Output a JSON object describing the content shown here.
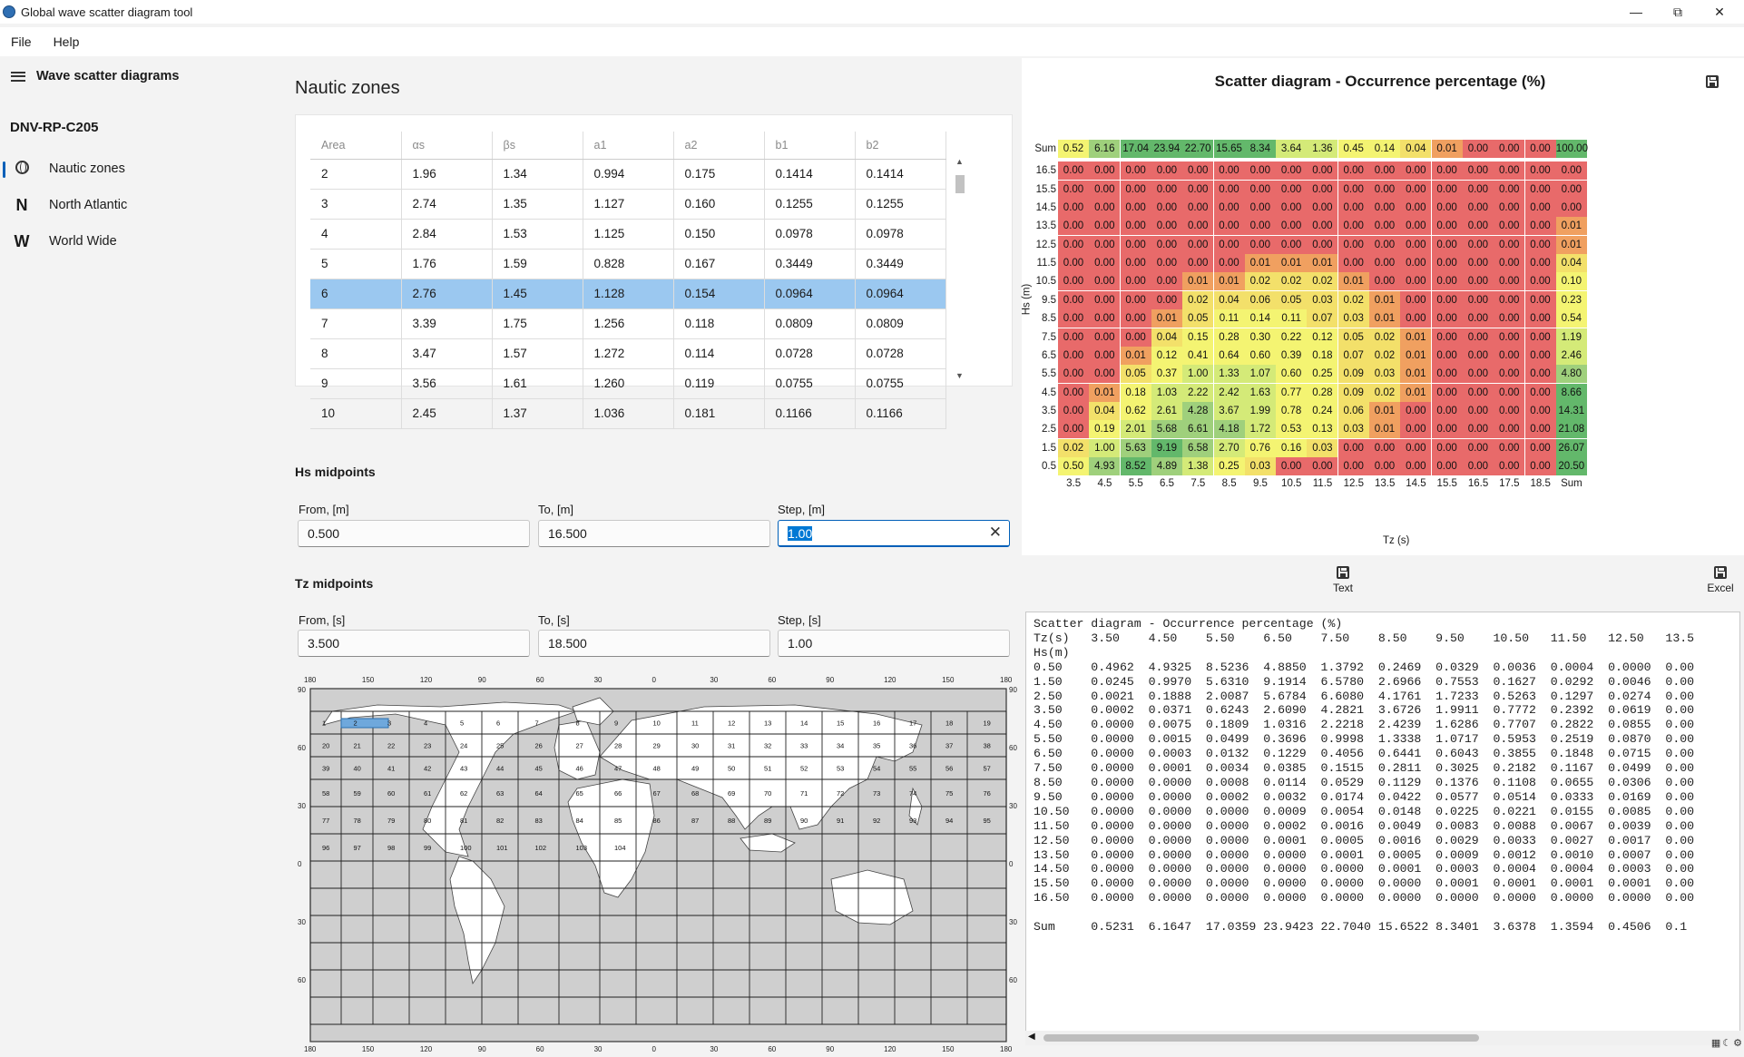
{
  "window": {
    "title": "Global wave scatter diagram tool"
  },
  "menu": {
    "file": "File",
    "help": "Help"
  },
  "sidebar": {
    "header": "Wave scatter diagrams",
    "group": "DNV-RP-C205",
    "items": [
      {
        "label": "Nautic zones",
        "icon": "globe-icon"
      },
      {
        "label": "North Atlantic",
        "icon": "N"
      },
      {
        "label": "World Wide",
        "icon": "W"
      }
    ]
  },
  "main": {
    "title": "Nautic zones",
    "table": {
      "headers": [
        "Area",
        "αs",
        "βs",
        "a1",
        "a2",
        "b1",
        "b2"
      ],
      "rows": [
        [
          "2",
          "1.96",
          "1.34",
          "0.994",
          "0.175",
          "0.1414",
          "0.1414"
        ],
        [
          "3",
          "2.74",
          "1.35",
          "1.127",
          "0.160",
          "0.1255",
          "0.1255"
        ],
        [
          "4",
          "2.84",
          "1.53",
          "1.125",
          "0.150",
          "0.0978",
          "0.0978"
        ],
        [
          "5",
          "1.76",
          "1.59",
          "0.828",
          "0.167",
          "0.3449",
          "0.3449"
        ],
        [
          "6",
          "2.76",
          "1.45",
          "1.128",
          "0.154",
          "0.0964",
          "0.0964"
        ],
        [
          "7",
          "3.39",
          "1.75",
          "1.256",
          "0.118",
          "0.0809",
          "0.0809"
        ],
        [
          "8",
          "3.47",
          "1.57",
          "1.272",
          "0.114",
          "0.0728",
          "0.0728"
        ],
        [
          "9",
          "3.56",
          "1.61",
          "1.260",
          "0.119",
          "0.0755",
          "0.0755"
        ],
        [
          "10",
          "2.45",
          "1.37",
          "1.036",
          "0.181",
          "0.1166",
          "0.1166"
        ]
      ],
      "selected_index": 4
    },
    "hs": {
      "title": "Hs midpoints",
      "from_label": "From, [m]",
      "from_value": "0.500",
      "to_label": "To, [m]",
      "to_value": "16.500",
      "step_label": "Step, [m]",
      "step_value": "1.00"
    },
    "tz": {
      "title": "Tz midpoints",
      "from_label": "From, [s]",
      "from_value": "3.500",
      "to_label": "To, [s]",
      "to_value": "18.500",
      "step_label": "Step, [s]",
      "step_value": "1.00"
    },
    "map": {
      "top_ticks": [
        "180",
        "150",
        "120",
        "90",
        "60",
        "30",
        "0",
        "30",
        "60",
        "90",
        "120",
        "150",
        "180"
      ],
      "left_ticks": [
        "90",
        "60",
        "30",
        "0",
        "30",
        "60"
      ],
      "zones": [
        "1",
        "2",
        "3",
        "4",
        "5",
        "6",
        "7",
        "8",
        "9",
        "10",
        "11",
        "12",
        "13",
        "14",
        "15",
        "16",
        "17",
        "18",
        "19",
        "20",
        "21",
        "22",
        "23",
        "24",
        "25",
        "26",
        "27",
        "28",
        "29",
        "30",
        "31",
        "32",
        "33",
        "34",
        "35",
        "36",
        "37",
        "38",
        "39",
        "40",
        "41",
        "42",
        "43",
        "44",
        "45",
        "46",
        "47",
        "48",
        "49",
        "50",
        "51",
        "52",
        "53",
        "54",
        "55",
        "56",
        "57",
        "58",
        "59",
        "60",
        "61",
        "62",
        "63",
        "64",
        "65",
        "66",
        "67",
        "68",
        "69",
        "70",
        "71",
        "72",
        "73",
        "74",
        "75",
        "76",
        "77",
        "78",
        "79",
        "80",
        "81",
        "82",
        "83",
        "84",
        "85",
        "86",
        "87",
        "88",
        "89",
        "90",
        "91",
        "92",
        "93",
        "94",
        "95",
        "96",
        "97",
        "98",
        "99",
        "100",
        "101",
        "102",
        "103",
        "104"
      ],
      "selected_zone": "6"
    }
  },
  "chart_data": {
    "type": "heatmap",
    "title": "Scatter diagram - Occurrence percentage (%)",
    "xlabel": "Tz (s)",
    "ylabel": "Hs (m)",
    "x": [
      "3.5",
      "4.5",
      "5.5",
      "6.5",
      "7.5",
      "8.5",
      "9.5",
      "10.5",
      "11.5",
      "12.5",
      "13.5",
      "14.5",
      "15.5",
      "16.5",
      "17.5",
      "18.5"
    ],
    "sum_col_label": "Sum",
    "sum_row_label": "Sum",
    "sum_row": [
      "0.52",
      "6.16",
      "17.04",
      "23.94",
      "22.70",
      "15.65",
      "8.34",
      "3.64",
      "1.36",
      "0.45",
      "0.14",
      "0.04",
      "0.01",
      "0.00",
      "0.00",
      "0.00",
      "100.00"
    ],
    "rows": [
      {
        "hs": "16.5",
        "values": [
          "0.00",
          "0.00",
          "0.00",
          "0.00",
          "0.00",
          "0.00",
          "0.00",
          "0.00",
          "0.00",
          "0.00",
          "0.00",
          "0.00",
          "0.00",
          "0.00",
          "0.00",
          "0.00"
        ],
        "sum": "0.00"
      },
      {
        "hs": "15.5",
        "values": [
          "0.00",
          "0.00",
          "0.00",
          "0.00",
          "0.00",
          "0.00",
          "0.00",
          "0.00",
          "0.00",
          "0.00",
          "0.00",
          "0.00",
          "0.00",
          "0.00",
          "0.00",
          "0.00"
        ],
        "sum": "0.00"
      },
      {
        "hs": "14.5",
        "values": [
          "0.00",
          "0.00",
          "0.00",
          "0.00",
          "0.00",
          "0.00",
          "0.00",
          "0.00",
          "0.00",
          "0.00",
          "0.00",
          "0.00",
          "0.00",
          "0.00",
          "0.00",
          "0.00"
        ],
        "sum": "0.00"
      },
      {
        "hs": "13.5",
        "values": [
          "0.00",
          "0.00",
          "0.00",
          "0.00",
          "0.00",
          "0.00",
          "0.00",
          "0.00",
          "0.00",
          "0.00",
          "0.00",
          "0.00",
          "0.00",
          "0.00",
          "0.00",
          "0.00"
        ],
        "sum": "0.01"
      },
      {
        "hs": "12.5",
        "values": [
          "0.00",
          "0.00",
          "0.00",
          "0.00",
          "0.00",
          "0.00",
          "0.00",
          "0.00",
          "0.00",
          "0.00",
          "0.00",
          "0.00",
          "0.00",
          "0.00",
          "0.00",
          "0.00"
        ],
        "sum": "0.01"
      },
      {
        "hs": "11.5",
        "values": [
          "0.00",
          "0.00",
          "0.00",
          "0.00",
          "0.00",
          "0.00",
          "0.01",
          "0.01",
          "0.01",
          "0.00",
          "0.00",
          "0.00",
          "0.00",
          "0.00",
          "0.00",
          "0.00"
        ],
        "sum": "0.04"
      },
      {
        "hs": "10.5",
        "values": [
          "0.00",
          "0.00",
          "0.00",
          "0.00",
          "0.01",
          "0.01",
          "0.02",
          "0.02",
          "0.02",
          "0.01",
          "0.00",
          "0.00",
          "0.00",
          "0.00",
          "0.00",
          "0.00"
        ],
        "sum": "0.10"
      },
      {
        "hs": "9.5",
        "values": [
          "0.00",
          "0.00",
          "0.00",
          "0.00",
          "0.02",
          "0.04",
          "0.06",
          "0.05",
          "0.03",
          "0.02",
          "0.01",
          "0.00",
          "0.00",
          "0.00",
          "0.00",
          "0.00"
        ],
        "sum": "0.23"
      },
      {
        "hs": "8.5",
        "values": [
          "0.00",
          "0.00",
          "0.00",
          "0.01",
          "0.05",
          "0.11",
          "0.14",
          "0.11",
          "0.07",
          "0.03",
          "0.01",
          "0.00",
          "0.00",
          "0.00",
          "0.00",
          "0.00"
        ],
        "sum": "0.54"
      },
      {
        "hs": "7.5",
        "values": [
          "0.00",
          "0.00",
          "0.00",
          "0.04",
          "0.15",
          "0.28",
          "0.30",
          "0.22",
          "0.12",
          "0.05",
          "0.02",
          "0.01",
          "0.00",
          "0.00",
          "0.00",
          "0.00"
        ],
        "sum": "1.19"
      },
      {
        "hs": "6.5",
        "values": [
          "0.00",
          "0.00",
          "0.01",
          "0.12",
          "0.41",
          "0.64",
          "0.60",
          "0.39",
          "0.18",
          "0.07",
          "0.02",
          "0.01",
          "0.00",
          "0.00",
          "0.00",
          "0.00"
        ],
        "sum": "2.46"
      },
      {
        "hs": "5.5",
        "values": [
          "0.00",
          "0.00",
          "0.05",
          "0.37",
          "1.00",
          "1.33",
          "1.07",
          "0.60",
          "0.25",
          "0.09",
          "0.03",
          "0.01",
          "0.00",
          "0.00",
          "0.00",
          "0.00"
        ],
        "sum": "4.80"
      },
      {
        "hs": "4.5",
        "values": [
          "0.00",
          "0.01",
          "0.18",
          "1.03",
          "2.22",
          "2.42",
          "1.63",
          "0.77",
          "0.28",
          "0.09",
          "0.02",
          "0.01",
          "0.00",
          "0.00",
          "0.00",
          "0.00"
        ],
        "sum": "8.66"
      },
      {
        "hs": "3.5",
        "values": [
          "0.00",
          "0.04",
          "0.62",
          "2.61",
          "4.28",
          "3.67",
          "1.99",
          "0.78",
          "0.24",
          "0.06",
          "0.01",
          "0.00",
          "0.00",
          "0.00",
          "0.00",
          "0.00"
        ],
        "sum": "14.31"
      },
      {
        "hs": "2.5",
        "values": [
          "0.00",
          "0.19",
          "2.01",
          "5.68",
          "6.61",
          "4.18",
          "1.72",
          "0.53",
          "0.13",
          "0.03",
          "0.01",
          "0.00",
          "0.00",
          "0.00",
          "0.00",
          "0.00"
        ],
        "sum": "21.08"
      },
      {
        "hs": "1.5",
        "values": [
          "0.02",
          "1.00",
          "5.63",
          "9.19",
          "6.58",
          "2.70",
          "0.76",
          "0.16",
          "0.03",
          "0.00",
          "0.00",
          "0.00",
          "0.00",
          "0.00",
          "0.00",
          "0.00"
        ],
        "sum": "26.07"
      },
      {
        "hs": "0.5",
        "values": [
          "0.50",
          "4.93",
          "8.52",
          "4.89",
          "1.38",
          "0.25",
          "0.03",
          "0.00",
          "0.00",
          "0.00",
          "0.00",
          "0.00",
          "0.00",
          "0.00",
          "0.00",
          "0.00"
        ],
        "sum": "20.50"
      }
    ]
  },
  "text_output": {
    "text_button": "Text",
    "excel_button": "Excel",
    "lines": [
      "Scatter diagram - Occurrence percentage (%)",
      "Tz(s)   3.50    4.50    5.50    6.50    7.50    8.50    9.50    10.50   11.50   12.50   13.5",
      "Hs(m)",
      "0.50    0.4962  4.9325  8.5236  4.8850  1.3792  0.2469  0.0329  0.0036  0.0004  0.0000  0.00",
      "1.50    0.0245  0.9970  5.6310  9.1914  6.5780  2.6966  0.7553  0.1627  0.0292  0.0046  0.00",
      "2.50    0.0021  0.1888  2.0087  5.6784  6.6080  4.1761  1.7233  0.5263  0.1297  0.0274  0.00",
      "3.50    0.0002  0.0371  0.6243  2.6090  4.2821  3.6726  1.9911  0.7772  0.2392  0.0619  0.00",
      "4.50    0.0000  0.0075  0.1809  1.0316  2.2218  2.4239  1.6286  0.7707  0.2822  0.0855  0.00",
      "5.50    0.0000  0.0015  0.0499  0.3696  0.9998  1.3338  1.0717  0.5953  0.2519  0.0870  0.00",
      "6.50    0.0000  0.0003  0.0132  0.1229  0.4056  0.6441  0.6043  0.3855  0.1848  0.0715  0.00",
      "7.50    0.0000  0.0001  0.0034  0.0385  0.1515  0.2811  0.3025  0.2182  0.1167  0.0499  0.00",
      "8.50    0.0000  0.0000  0.0008  0.0114  0.0529  0.1129  0.1376  0.1108  0.0655  0.0306  0.00",
      "9.50    0.0000  0.0000  0.0002  0.0032  0.0174  0.0422  0.0577  0.0514  0.0333  0.0169  0.00",
      "10.50   0.0000  0.0000  0.0000  0.0009  0.0054  0.0148  0.0225  0.0221  0.0155  0.0085  0.00",
      "11.50   0.0000  0.0000  0.0000  0.0002  0.0016  0.0049  0.0083  0.0088  0.0067  0.0039  0.00",
      "12.50   0.0000  0.0000  0.0000  0.0001  0.0005  0.0016  0.0029  0.0033  0.0027  0.0017  0.00",
      "13.50   0.0000  0.0000  0.0000  0.0000  0.0001  0.0005  0.0009  0.0012  0.0010  0.0007  0.00",
      "14.50   0.0000  0.0000  0.0000  0.0000  0.0000  0.0001  0.0003  0.0004  0.0004  0.0003  0.00",
      "15.50   0.0000  0.0000  0.0000  0.0000  0.0000  0.0000  0.0001  0.0001  0.0001  0.0001  0.00",
      "16.50   0.0000  0.0000  0.0000  0.0000  0.0000  0.0000  0.0000  0.0000  0.0000  0.0000  0.00",
      "",
      "Sum     0.5231  6.1647  17.0359 23.9423 22.7040 15.6522 8.3401  3.6378  1.3594  0.4506  0.1"
    ]
  },
  "colors": {
    "accent": "#005fb8",
    "selection": "#9bc8f0",
    "heat_low": "#e86a6a",
    "heat_mid": "#f4f472",
    "heat_high": "#63b86b"
  }
}
